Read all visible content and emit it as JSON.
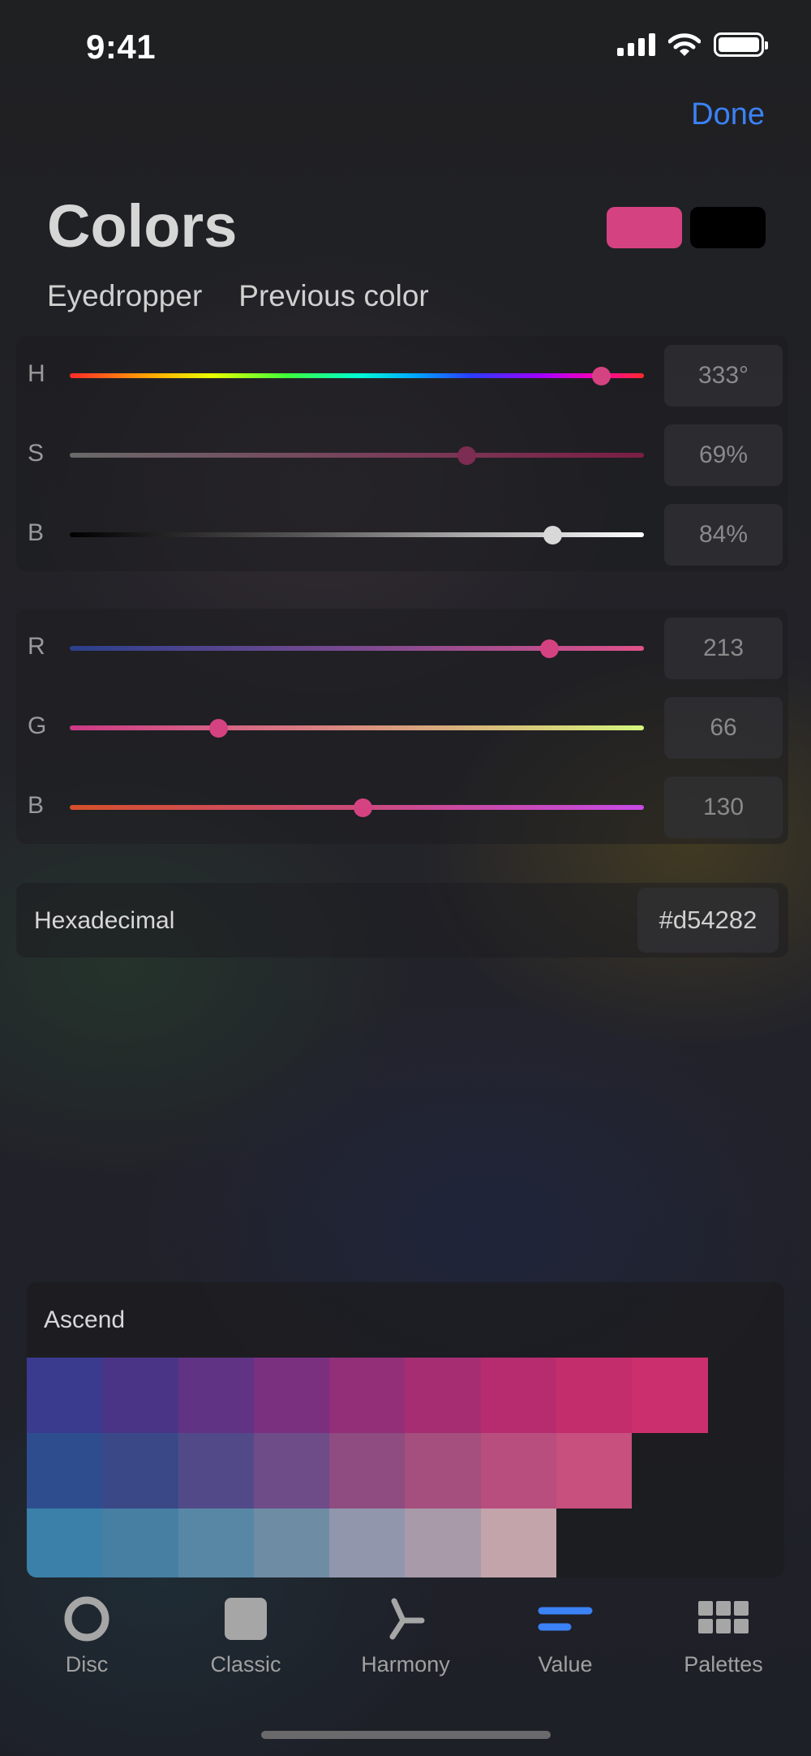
{
  "status_bar": {
    "time": "9:41",
    "signal_icon": "cellular-signal-icon",
    "wifi_icon": "wifi-icon",
    "battery_icon": "battery-icon"
  },
  "header": {
    "done_label": "Done",
    "title": "Colors"
  },
  "colors": {
    "current": "#d54282",
    "previous": "#000000",
    "accent": "#3b82f6"
  },
  "actions": {
    "eyedropper": "Eyedropper",
    "previous_color": "Previous color"
  },
  "hsb": {
    "hue": {
      "label": "H",
      "value": "333°",
      "level": 0.925
    },
    "saturation": {
      "label": "S",
      "value": "69%",
      "level": 0.69
    },
    "brightness": {
      "label": "B",
      "value": "84%",
      "level": 0.84
    }
  },
  "rgb": {
    "red": {
      "label": "R",
      "value": "213",
      "level": 0.835
    },
    "green": {
      "label": "G",
      "value": "66",
      "level": 0.259
    },
    "blue": {
      "label": "B",
      "value": "130",
      "level": 0.51
    }
  },
  "hex": {
    "label": "Hexadecimal",
    "value": "#d54282"
  },
  "palette": {
    "title": "Ascend",
    "rows": [
      [
        "#3a3a8f",
        "#4a3485",
        "#603385",
        "#7a307f",
        "#922f78",
        "#a62d72",
        "#b72c6e",
        "#c42d6c",
        "#cc2f6d"
      ],
      [
        "#2e4d8e",
        "#3b4888",
        "#524a88",
        "#6d4c88",
        "#8e4c80",
        "#a44f7e",
        "#b84e7d",
        "#c8507e"
      ],
      [
        "#3a80a8",
        "#467fa2",
        "#5887a5",
        "#6f8ca5",
        "#9196ad",
        "#a89aa9",
        "#c2a4aa"
      ]
    ]
  },
  "tabs": [
    {
      "label": "Disc",
      "icon": "disc-icon"
    },
    {
      "label": "Classic",
      "icon": "classic-square-icon"
    },
    {
      "label": "Harmony",
      "icon": "harmony-icon"
    },
    {
      "label": "Value",
      "icon": "value-sliders-icon"
    },
    {
      "label": "Palettes",
      "icon": "palettes-grid-icon"
    }
  ]
}
